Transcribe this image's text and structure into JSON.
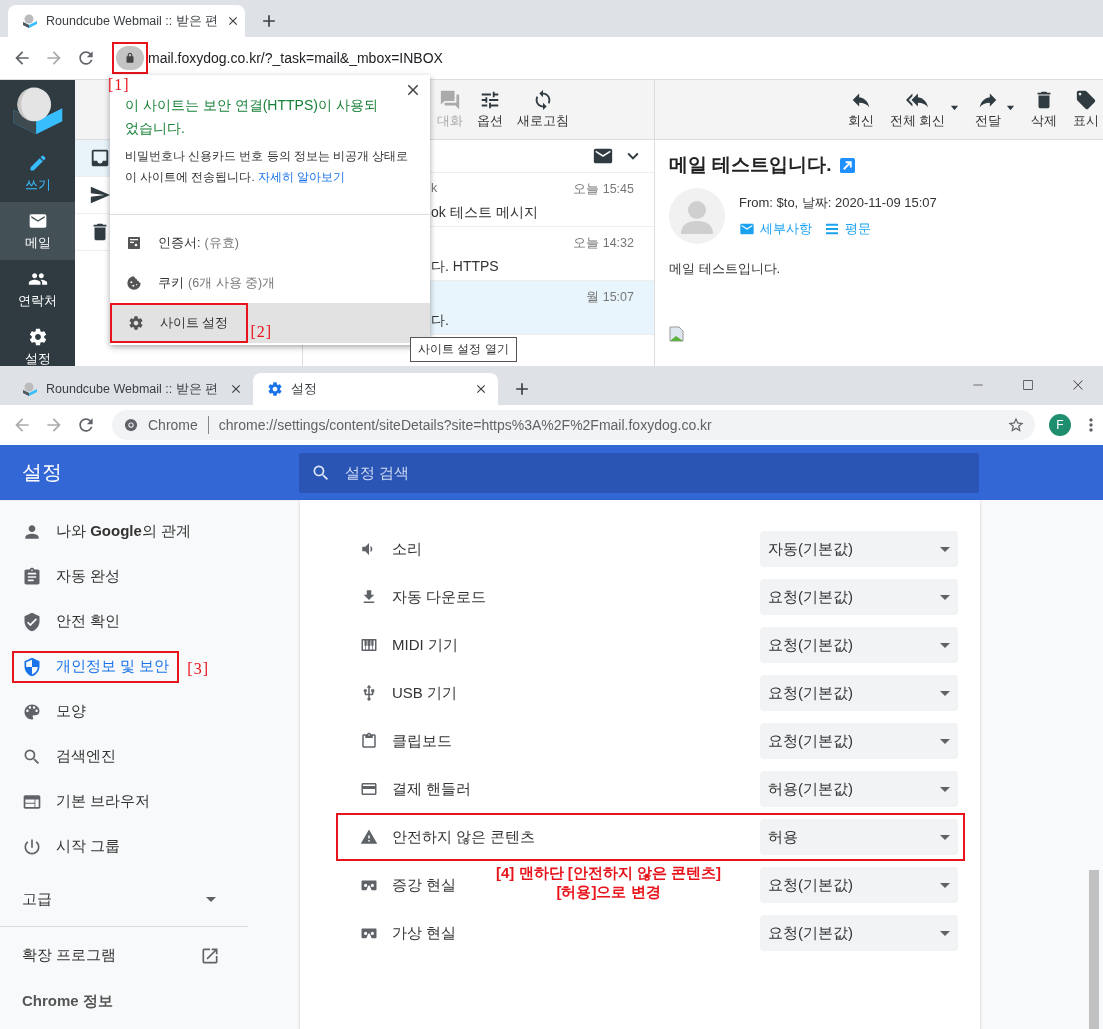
{
  "top_browser": {
    "tabs": [
      {
        "title": "Roundcube Webmail :: 받은 편",
        "selected": true
      }
    ],
    "url": "mail.foxydog.co.kr/?_task=mail&_mbox=INBOX",
    "lock_callout": "[1]",
    "app_nav": [
      {
        "kind": "compose",
        "label": "쓰기",
        "selected": false
      },
      {
        "kind": "mail",
        "label": "메일",
        "selected": true
      },
      {
        "kind": "contacts",
        "label": "연락처",
        "selected": false
      },
      {
        "kind": "settings",
        "label": "설정",
        "selected": false
      }
    ],
    "folders": [
      {
        "kind": "inbox",
        "selected": true
      },
      {
        "kind": "sent",
        "selected": false
      },
      {
        "kind": "trash",
        "selected": false
      }
    ],
    "list_toolbar": [
      {
        "kind": "threads",
        "label": "대화",
        "disabled": true
      },
      {
        "kind": "options",
        "label": "옵션",
        "disabled": false
      },
      {
        "kind": "refresh",
        "label": "새로고침",
        "disabled": false
      }
    ],
    "messages": [
      {
        "sender": "k",
        "time": "오늘 15:45",
        "subject": "ok 테스트 메시지",
        "selected": false
      },
      {
        "time": "오늘 14:32",
        "subject": "다. HTTPS",
        "selected": false
      },
      {
        "time": "월 15:07",
        "subject": "다.",
        "selected": true
      }
    ],
    "message_toolbar": [
      {
        "kind": "reply",
        "label": "회신",
        "menu": false
      },
      {
        "kind": "reply_all",
        "label": "전체 회신",
        "menu": true
      },
      {
        "kind": "forward",
        "label": "전달",
        "menu": true
      },
      {
        "kind": "delete",
        "label": "삭제",
        "menu": false
      },
      {
        "kind": "mark",
        "label": "표시",
        "menu": false
      }
    ],
    "message": {
      "subject": "메일 테스트입니다.",
      "header": "From: $to, 날짜: 2020-11-09 15:07",
      "links": [
        {
          "kind": "details",
          "label": "세부사항"
        },
        {
          "kind": "plain",
          "label": "평문"
        }
      ],
      "body": "메일 테스트입니다."
    },
    "site_info": {
      "title": "이 사이트는 보안 연결(HTTPS)이 사용되었습니다.",
      "description": "비밀번호나 신용카드 번호 등의 정보는 비공개 상태로 이 사이트에 전송됩니다.",
      "link": "자세히 알아보기",
      "items": [
        {
          "kind": "certificate",
          "label": "인증서:",
          "detail": "(유효)",
          "selected": false
        },
        {
          "kind": "cookies",
          "label": "쿠키",
          "detail": "(6개 사용 중)개",
          "selected": false
        },
        {
          "kind": "site_settings",
          "label": "사이트 설정",
          "selected": true,
          "callout": "[2]"
        }
      ]
    },
    "tooltip": "사이트 설정 열기"
  },
  "settings_browser": {
    "tabs": [
      {
        "kind": "roundcube",
        "title": "Roundcube Webmail :: 받은 편",
        "selected": false
      },
      {
        "kind": "settings",
        "title": "설정",
        "selected": true
      }
    ],
    "omnibox": {
      "origin": "Chrome",
      "url": "chrome://settings/content/siteDetails?site=https%3A%2F%2Fmail.foxydog.co.kr"
    },
    "profile": "F",
    "header": {
      "title": "설정",
      "search_placeholder": "설정 검색"
    },
    "nav": [
      {
        "kind": "people",
        "label": "나와 **Google**의 관계",
        "selected": false
      },
      {
        "kind": "autofill",
        "label": "자동 완성",
        "selected": false
      },
      {
        "kind": "safety",
        "label": "안전 확인",
        "selected": false
      },
      {
        "kind": "privacy",
        "label": "개인정보 및 보안",
        "selected": true,
        "callout": "[3]"
      },
      {
        "kind": "appearance",
        "label": "모양",
        "selected": false
      },
      {
        "kind": "search",
        "label": "검색엔진",
        "selected": false
      },
      {
        "kind": "browser",
        "label": "기본 브라우저",
        "selected": false
      },
      {
        "kind": "startup",
        "label": "시작 그룹",
        "selected": false
      }
    ],
    "advanced": {
      "label": "고급",
      "expanded": false
    },
    "extensions": "확장 프로그램",
    "about": "Chrome 정보",
    "permissions": [
      {
        "kind": "sound",
        "label": "소리",
        "value": "자동(기본값)"
      },
      {
        "kind": "download",
        "label": "자동 다운로드",
        "value": "요청(기본값)"
      },
      {
        "kind": "midi",
        "label": "MIDI 기기",
        "value": "요청(기본값)"
      },
      {
        "kind": "usb",
        "label": "USB 기기",
        "value": "요청(기본값)"
      },
      {
        "kind": "clipboard",
        "label": "클립보드",
        "value": "요청(기본값)"
      },
      {
        "kind": "payment",
        "label": "결제 핸들러",
        "value": "허용(기본값)"
      },
      {
        "kind": "insecure",
        "label": "안전하지 않은 콘텐츠",
        "value": "허용",
        "callout": [
          "[4] 맨하단 [안전하지 않은 콘텐츠]",
          "[허용]으로 변경"
        ]
      },
      {
        "kind": "ar",
        "label": "증강 현실",
        "value": "요청(기본값)"
      },
      {
        "kind": "vr",
        "label": "가상 현실",
        "value": "요청(기본값)"
      }
    ]
  }
}
